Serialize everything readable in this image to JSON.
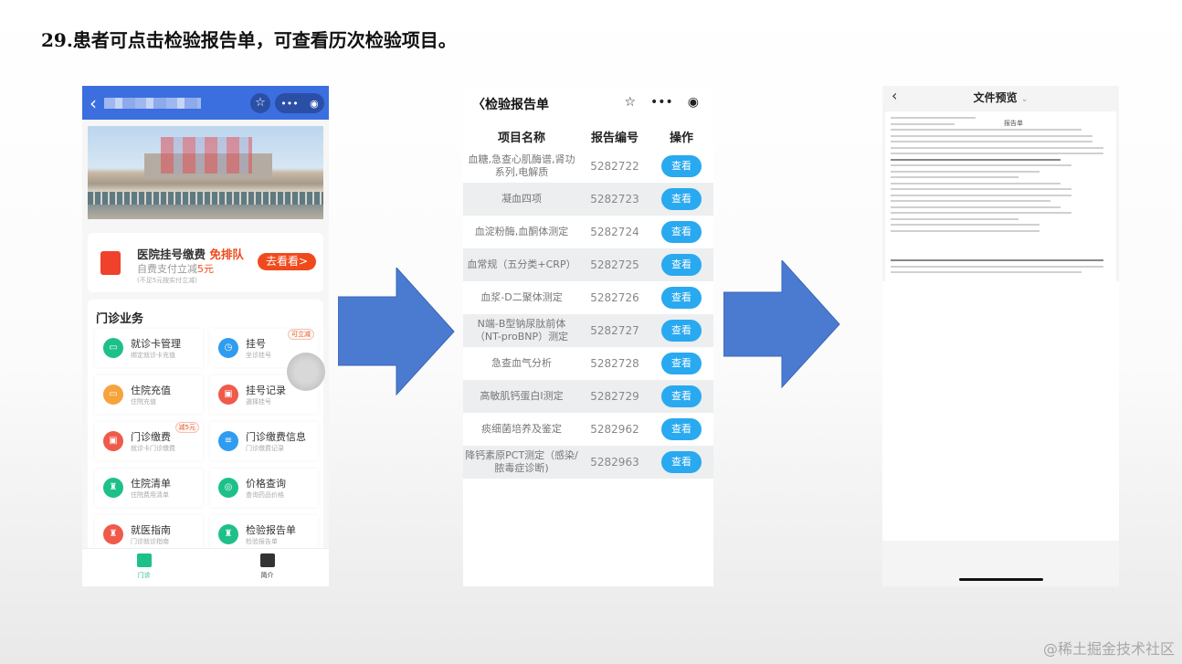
{
  "slide": {
    "title": "29.患者可点击检验报告单，可查看历次检验项目。",
    "watermark": "@稀土掘金技术社区"
  },
  "phone1": {
    "promo": {
      "title": "医院挂号缴费",
      "highlight": "免排队",
      "sub": "自费支付立减",
      "amount": "5元",
      "note": "(不足5元按实付立减)",
      "button": "去看看>"
    },
    "section_title": "门诊业务",
    "services": [
      {
        "name": "就诊卡管理",
        "sub": "绑定就诊卡充值",
        "color": "#1ec089",
        "icon": "card-icon",
        "glyph": "▭"
      },
      {
        "name": "挂号",
        "sub": "坐诊挂号",
        "color": "#2f9cf0",
        "icon": "clock-icon",
        "glyph": "◷",
        "tag": "可立减"
      },
      {
        "name": "住院充值",
        "sub": "住院充值",
        "color": "#f5a33c",
        "icon": "card-icon",
        "glyph": "▭"
      },
      {
        "name": "挂号记录",
        "sub": "選择挂号",
        "color": "#f05a4a",
        "icon": "record-icon",
        "glyph": "▣"
      },
      {
        "name": "门诊缴费",
        "sub": "就诊卡门诊缴费",
        "color": "#f05a4a",
        "icon": "payment-icon",
        "glyph": "▣",
        "tag": "减5元"
      },
      {
        "name": "门诊缴费信息",
        "sub": "门诊缴费记录",
        "color": "#2f9cf0",
        "icon": "list-icon",
        "glyph": "≡"
      },
      {
        "name": "住院清单",
        "sub": "住院费用清单",
        "color": "#1ec089",
        "icon": "bill-icon",
        "glyph": "♜"
      },
      {
        "name": "价格查询",
        "sub": "查询药品价格",
        "color": "#1ec089",
        "icon": "search-icon",
        "glyph": "◎"
      },
      {
        "name": "就医指南",
        "sub": "门诊就诊指南",
        "color": "#f05a4a",
        "icon": "guide-icon",
        "glyph": "♜"
      },
      {
        "name": "检验报告单",
        "sub": "检验报告单",
        "color": "#1ec089",
        "icon": "report-icon",
        "glyph": "♜"
      }
    ],
    "tabs": [
      {
        "label": "门诊",
        "color": "#1ec089"
      },
      {
        "label": "简介",
        "color": "#333333"
      }
    ]
  },
  "phone2": {
    "title": "检验报告单",
    "columns": [
      "项目名称",
      "报告编号",
      "操作"
    ],
    "rows": [
      {
        "name": "血糖,急查心肌酶谱,肾功系列,电解质",
        "id": "5282722",
        "action": "查看"
      },
      {
        "name": "凝血四项",
        "id": "5282723",
        "action": "查看"
      },
      {
        "name": "血淀粉酶,血酮体测定",
        "id": "5282724",
        "action": "查看"
      },
      {
        "name": "血常规（五分类+CRP）",
        "id": "5282725",
        "action": "查看"
      },
      {
        "name": "血浆-D二聚体测定",
        "id": "5282726",
        "action": "查看"
      },
      {
        "name": "N端-B型钠尿肽前体（NT-proBNP）测定",
        "id": "5282727",
        "action": "查看"
      },
      {
        "name": "急查血气分析",
        "id": "5282728",
        "action": "查看"
      },
      {
        "name": "高敏肌钙蛋白I测定",
        "id": "5282729",
        "action": "查看"
      },
      {
        "name": "痰细菌培养及鉴定",
        "id": "5282962",
        "action": "查看"
      },
      {
        "name": "降钙素原PCT测定（感染/脓毒症诊断)",
        "id": "5282963",
        "action": "查看"
      }
    ]
  },
  "phone3": {
    "title": "文件预览",
    "doc_title": "报告单"
  },
  "colors": {
    "primary_blue": "#3b6fe0",
    "button_blue": "#29a9f0",
    "arrow_blue": "#4a7bd0",
    "accent_orange": "#f04a1c"
  }
}
